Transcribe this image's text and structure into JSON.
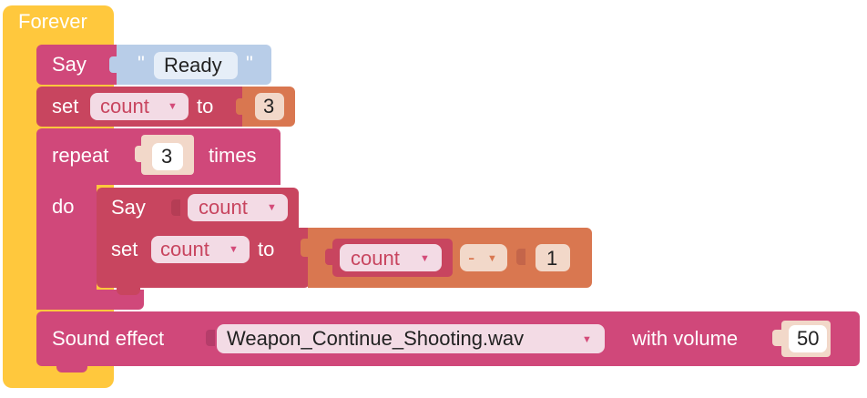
{
  "forever": {
    "label": "Forever"
  },
  "say1": {
    "label": "Say",
    "quote_open": "\"",
    "text": "Ready",
    "quote_close": "\""
  },
  "set1": {
    "label": "set",
    "var": "count",
    "to": "to",
    "value": "3"
  },
  "repeat": {
    "label": "repeat",
    "count": "3",
    "times": "times",
    "do": "do"
  },
  "say2": {
    "label": "Say",
    "var": "count"
  },
  "set2": {
    "label": "set",
    "var": "count",
    "to": "to",
    "expr_var": "count",
    "op": "-",
    "operand": "1"
  },
  "sound": {
    "label": "Sound effect",
    "file": "Weapon_Continue_Shooting.wav",
    "with_volume": "with volume",
    "volume": "50"
  },
  "colors": {
    "forever": "#ffc83d",
    "block_pink": "#d0487a",
    "block_red": "#c8455f",
    "block_orange": "#d97750",
    "text_block": "#b8cde8",
    "number_slot": "#f2d8c9",
    "dropdown": "#f3dbe5"
  }
}
